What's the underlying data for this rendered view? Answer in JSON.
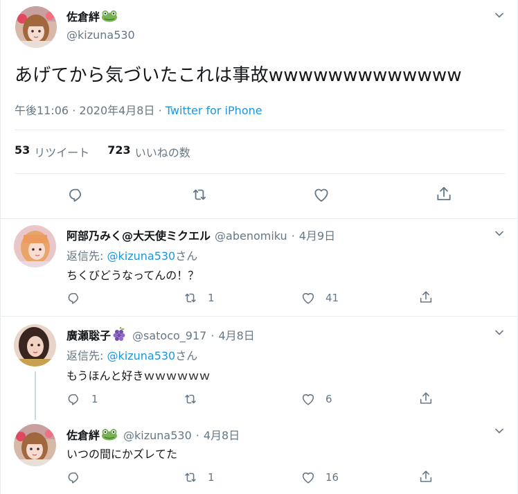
{
  "main_tweet": {
    "display_name": "佐倉絆",
    "handle": "@kizuna530",
    "text": "あげてから気づいたこれは事故wwwwwwwwwwwww",
    "time": "午後11:06",
    "date": "2020年4月8日",
    "separator": "·",
    "client": "Twitter for iPhone",
    "retweet_count": "53",
    "retweet_label": "リツイート",
    "like_count": "723",
    "like_label": "いいねの数"
  },
  "replies": [
    {
      "display_name": "阿部乃みく@大天使ミクエル",
      "handle": "@abenomiku",
      "separator": "·",
      "date": "4月9日",
      "reply_to_label": "返信先:",
      "reply_to_handle": "@kizuna530",
      "reply_to_suffix": "さん",
      "text": "ちくびどうなってんの！？",
      "reply_count": "",
      "retweet_count": "1",
      "like_count": "41"
    },
    {
      "display_name": "廣瀬聡子",
      "handle": "@satoco_917",
      "separator": "·",
      "date": "4月8日",
      "reply_to_label": "返信先:",
      "reply_to_handle": "@kizuna530",
      "reply_to_suffix": "さん",
      "text": "もうほんと好きｗｗｗｗｗｗ",
      "reply_count": "1",
      "retweet_count": "",
      "like_count": "6"
    },
    {
      "display_name": "佐倉絆",
      "handle": "@kizuna530",
      "separator": "·",
      "date": "4月8日",
      "text": "いつの間にかズレてた",
      "reply_count": "",
      "retweet_count": "1",
      "like_count": "16"
    }
  ],
  "icons": {
    "frog": "frog-emoji-icon",
    "grapes": "grapes-emoji-icon",
    "reply": "reply-icon",
    "retweet": "retweet-icon",
    "like": "heart-icon",
    "share": "share-icon",
    "caret": "chevron-down-icon"
  },
  "colors": {
    "link": "#1b95e0",
    "muted": "#657786",
    "text": "#14171a",
    "border": "#e6ecf0",
    "thread_line": "#ccd6dd"
  }
}
